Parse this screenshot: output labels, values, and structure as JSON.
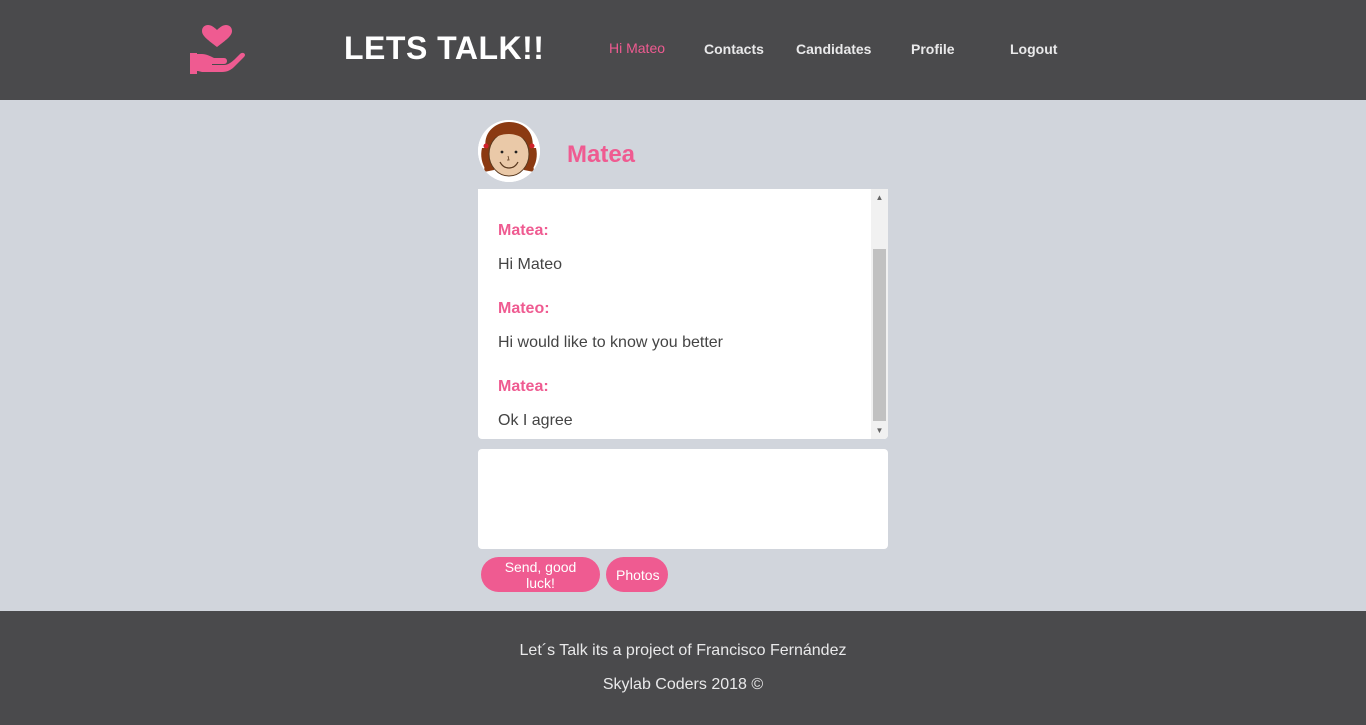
{
  "header": {
    "brand": "LETS TALK!!",
    "logo_icon": "heart-hand-icon",
    "nav": [
      {
        "label": "Hi Mateo",
        "active": true
      },
      {
        "label": "Contacts"
      },
      {
        "label": "Candidates"
      },
      {
        "label": "Profile"
      },
      {
        "label": "Logout"
      }
    ]
  },
  "contact": {
    "name": "Matea",
    "avatar_icon": "girl-avatar-icon"
  },
  "chat": {
    "partial_previous": "Hi Mateo",
    "messages": [
      {
        "sender": "Matea:",
        "text": "Hi Mateo"
      },
      {
        "sender": "Mateo:",
        "text": "Hi would like to know you better"
      },
      {
        "sender": "Matea:",
        "text": "Ok I agree"
      }
    ]
  },
  "compose": {
    "value": "",
    "placeholder": ""
  },
  "buttons": {
    "send": "Send, good luck!",
    "photos": "Photos"
  },
  "footer": {
    "line1": "Let´s Talk its a project of Francisco Fernández",
    "line2": "Skylab Coders 2018 ©"
  },
  "colors": {
    "accent": "#ef5b91",
    "header_bg": "#4a4a4c",
    "page_bg": "#d1d5dc"
  }
}
